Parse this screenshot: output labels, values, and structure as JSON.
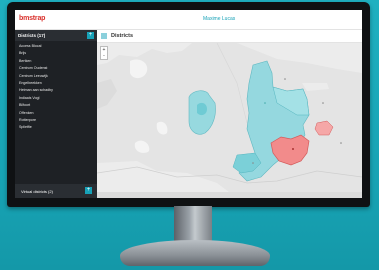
{
  "header": {
    "logo": "bmstrap",
    "org": "Maxime Lucas"
  },
  "sidebar": {
    "title": "Districts (17)",
    "add_label": "+",
    "items": [
      "Access Blocal",
      "Brijs",
      "Bertken",
      "Centrum Oudenst",
      "Centrum Leeuwijk",
      "Engelbeekken",
      "Hetman aan schadby",
      "Indiaals Vogl",
      "Bilfoort",
      "Offenken",
      "Rotterpore",
      "Splietfie"
    ],
    "footer_label": "Virtual districts (2)",
    "footer_add_label": "+"
  },
  "main": {
    "title": "Districts",
    "zoom_in": "+",
    "zoom_out": "-"
  },
  "colors": {
    "accent": "#17a2b8",
    "district_fill": "#8fd8df",
    "highlight": "#f28b8b"
  }
}
